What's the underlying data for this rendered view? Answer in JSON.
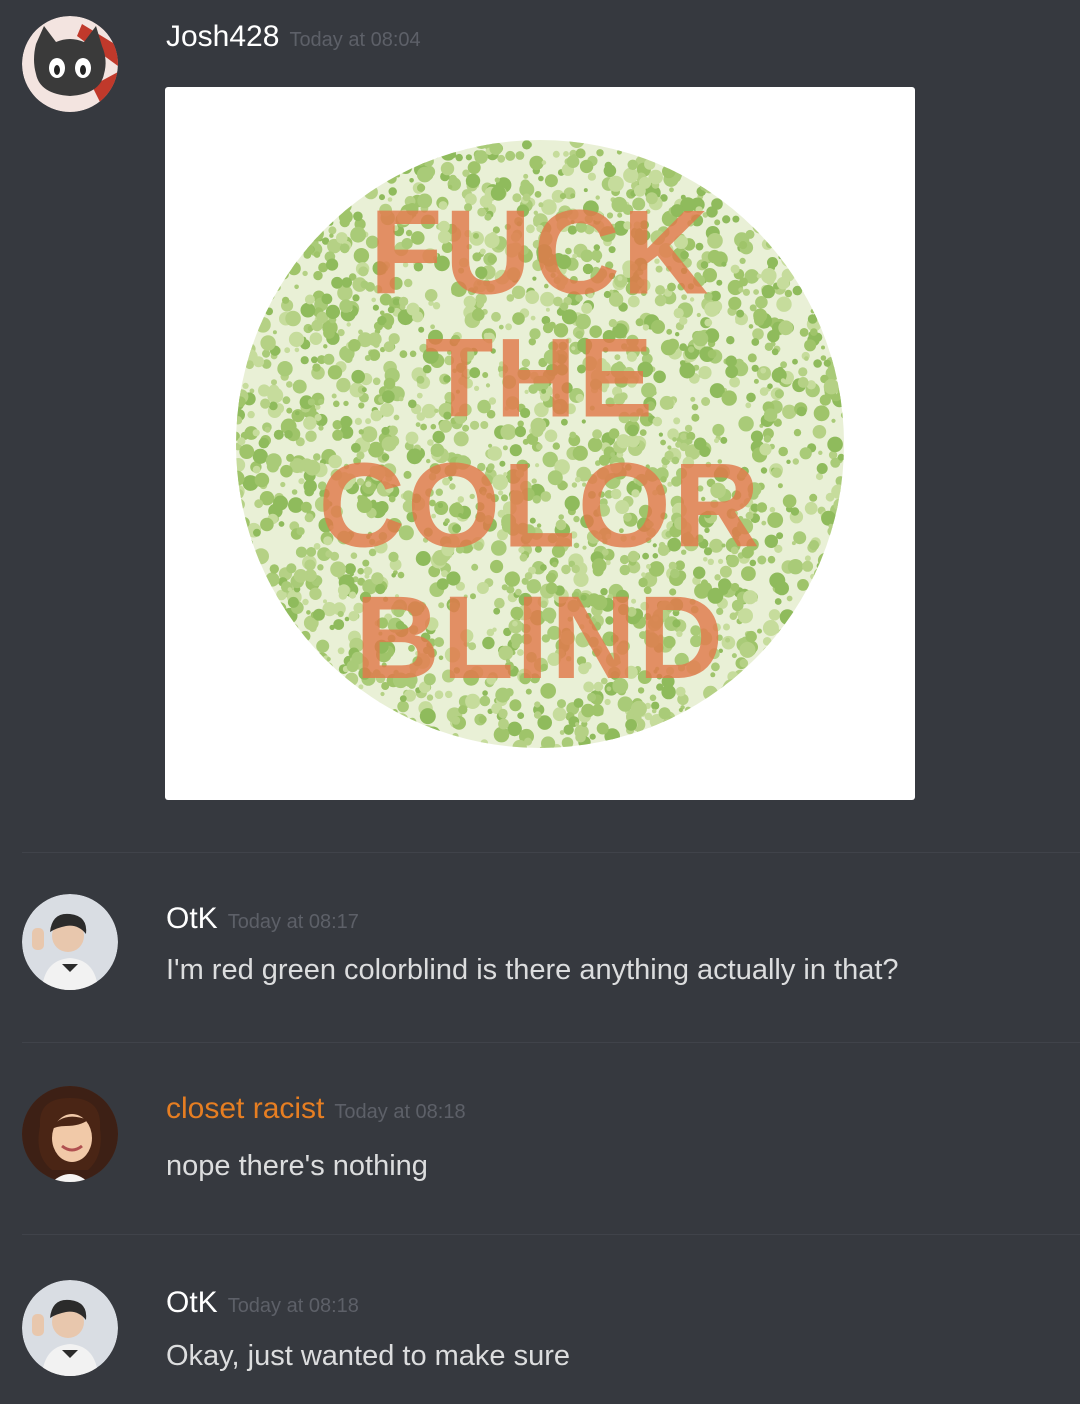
{
  "messages": [
    {
      "username": "Josh428",
      "timestamp": "Today at 08:04",
      "username_color": "#ffffff",
      "avatar_icon": "cat-icon",
      "attachment": {
        "text_lines": [
          "FUCK",
          "THE",
          "COLOR",
          "BLIND"
        ],
        "dot_color": "#9fc46a",
        "letter_color": "#e0794a"
      }
    },
    {
      "username": "OtK",
      "timestamp": "Today at 08:17",
      "username_color": "#ffffff",
      "avatar_icon": "person-avatar-icon",
      "text": "I'm red green colorblind is there anything actually in that?"
    },
    {
      "username": "closet racist",
      "timestamp": "Today at 08:18",
      "username_color": "#e67e22",
      "avatar_icon": "person-avatar-icon",
      "text": "nope there's nothing"
    },
    {
      "username": "OtK",
      "timestamp": "Today at 08:18",
      "username_color": "#ffffff",
      "avatar_icon": "person-avatar-icon",
      "text": "Okay, just wanted to make sure"
    }
  ]
}
